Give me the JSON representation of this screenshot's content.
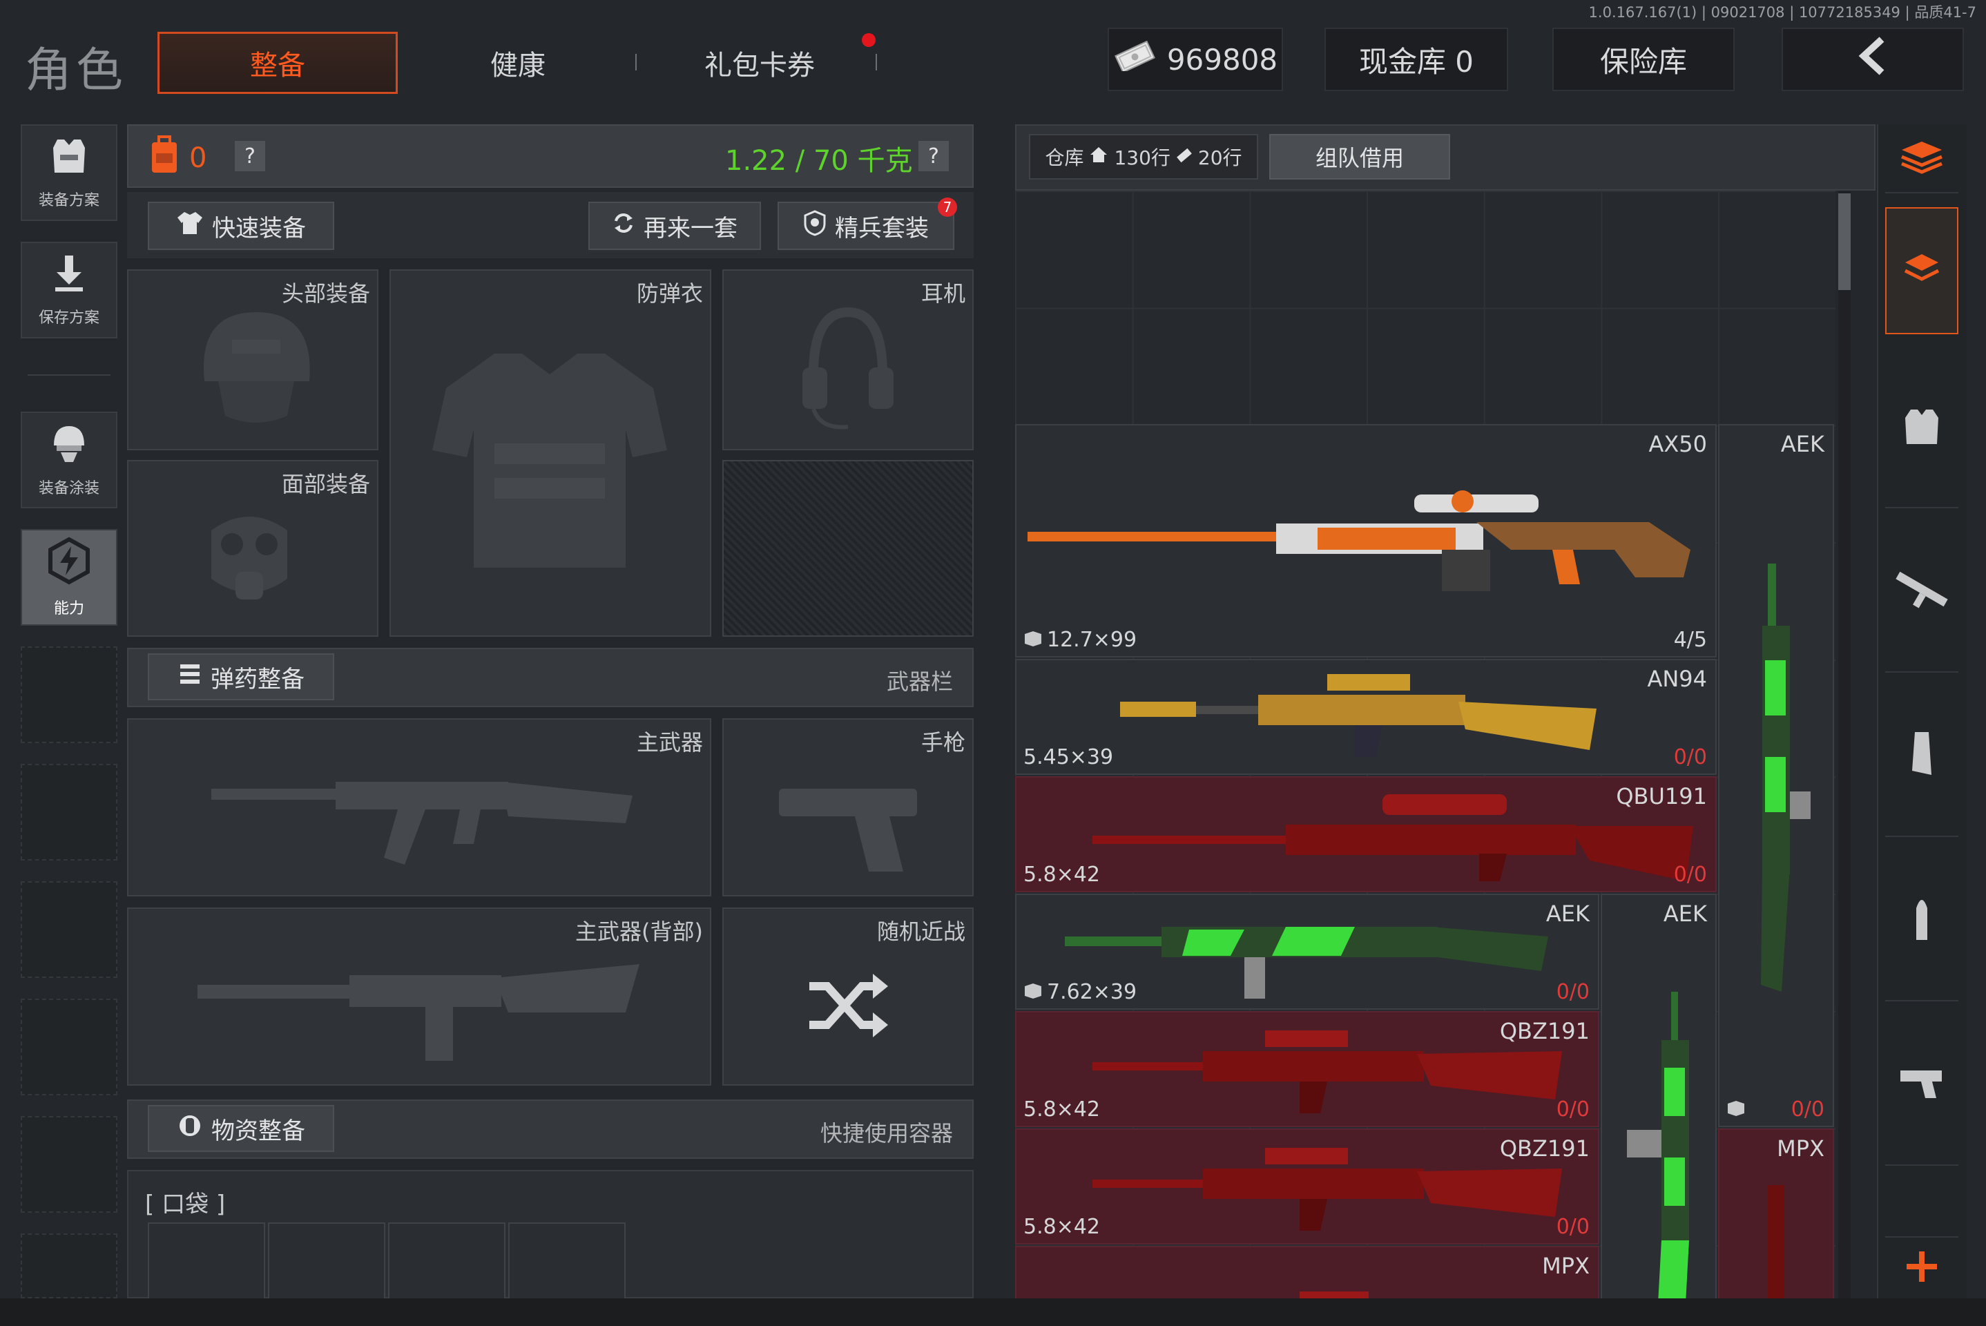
{
  "version_text": "1.0.167.167(1) | 09021708 | 10772185349 | 品质41-7",
  "page_title": "角色",
  "tabs": {
    "equip": "整备",
    "health": "健康",
    "gift": "礼包卡券"
  },
  "currency": {
    "money": "969808",
    "vault": "现金库 0",
    "safe": "保险库"
  },
  "left_rail": {
    "plan": "装备方案",
    "save": "保存方案",
    "paint": "装备涂装",
    "ability": "能力"
  },
  "equip": {
    "pack_count": "0",
    "help": "?",
    "weight": "1.22 / 70 千克",
    "quick_equip": "快速装备",
    "again": "再来一套",
    "elite": "精兵套装",
    "elite_badge": "7",
    "slots": {
      "head": "头部装备",
      "armor": "防弹衣",
      "ear": "耳机",
      "face": "面部装备"
    },
    "ammo_section": "弹药整备",
    "weapon_bar": "武器栏",
    "weapons": {
      "primary": "主武器",
      "pistol": "手枪",
      "primary_back": "主武器(背部)",
      "melee": "随机近战"
    },
    "supply_section": "物资整备",
    "quick_container": "快捷使用容器",
    "pocket": "[ 口袋 ]"
  },
  "warehouse": {
    "label": "仓库",
    "rows_home": "130行",
    "rows_ext": "20行",
    "borrow": "组队借用",
    "items": [
      {
        "name": "AX50",
        "ammo": "12.7×99",
        "count": "4/5"
      },
      {
        "name": "AN94",
        "ammo": "5.45×39",
        "count": "0/0"
      },
      {
        "name": "QBU191",
        "ammo": "5.8×42",
        "count": "0/0"
      },
      {
        "name": "AEK",
        "ammo": "7.62×39",
        "count": "0/0"
      },
      {
        "name": "QBZ191",
        "ammo": "5.8×42",
        "count": "0/0"
      },
      {
        "name": "QBZ191",
        "ammo": "5.8×42",
        "count": "0/0"
      },
      {
        "name": "MPX",
        "ammo": "",
        "count": ""
      },
      {
        "name": "AEK",
        "ammo": "",
        "count": "0/0"
      },
      {
        "name": "AEK",
        "ammo": "",
        "count": ""
      },
      {
        "name": "MPX",
        "ammo": "",
        "count": ""
      }
    ]
  },
  "colors": {
    "accent": "#ef5a1c",
    "weight_green": "#5ed32c",
    "alert_red": "#e13a3a",
    "red_tile": "#4c1c27"
  },
  "icons": [
    "cash-icon",
    "back-arrow-icon",
    "vest-icon",
    "download-icon",
    "helmet-icon",
    "ability-icon",
    "backpack-icon",
    "shirt-icon",
    "refresh-icon",
    "shield-icon",
    "ammo-icon",
    "supply-icon",
    "shuffle-icon",
    "home-icon",
    "ticket-icon",
    "stack-icon",
    "armor-icon",
    "rifle-icon",
    "magazine-icon",
    "bullet-icon",
    "pistol-icon",
    "plus-icon"
  ]
}
